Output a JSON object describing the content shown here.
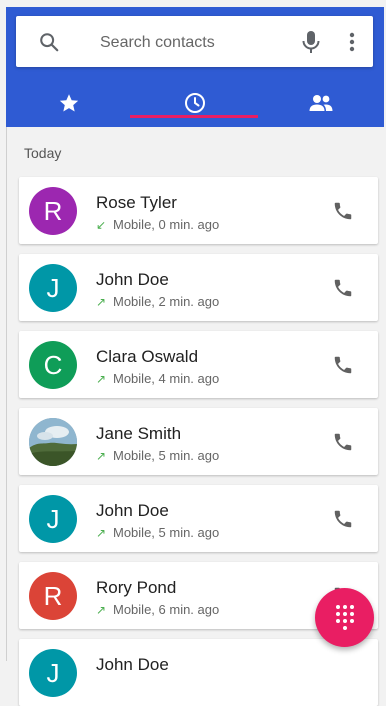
{
  "search": {
    "placeholder": "Search contacts"
  },
  "tabs": [
    {
      "icon": "star-icon",
      "label": "Favorites"
    },
    {
      "icon": "clock-icon",
      "label": "Recents"
    },
    {
      "icon": "people-icon",
      "label": "Contacts"
    }
  ],
  "colors": {
    "appbar": "#2f5bd3",
    "accent": "#e91e63",
    "incoming": "#4caf50",
    "outgoing": "#4caf50"
  },
  "section_title": "Today",
  "calls": [
    {
      "name": "Rose Tyler",
      "initial": "R",
      "avatar_color": "#9c27b0",
      "direction": "incoming",
      "arrow": "↙",
      "detail": "Mobile, 0 min. ago"
    },
    {
      "name": "John Doe",
      "initial": "J",
      "avatar_color": "#0097a7",
      "direction": "outgoing",
      "arrow": "↗",
      "detail": "Mobile, 2 min. ago"
    },
    {
      "name": "Clara Oswald",
      "initial": "C",
      "avatar_color": "#0f9d58",
      "direction": "outgoing",
      "arrow": "↗",
      "detail": "Mobile, 4 min. ago"
    },
    {
      "name": "Jane Smith",
      "initial": "",
      "avatar_color": "#7a9aa8",
      "direction": "outgoing",
      "arrow": "↗",
      "detail": "Mobile, 5 min. ago"
    },
    {
      "name": "John Doe",
      "initial": "J",
      "avatar_color": "#0097a7",
      "direction": "outgoing",
      "arrow": "↗",
      "detail": "Mobile, 5 min. ago"
    },
    {
      "name": "Rory Pond",
      "initial": "R",
      "avatar_color": "#db4437",
      "direction": "outgoing",
      "arrow": "↗",
      "detail": "Mobile, 6 min. ago"
    },
    {
      "name": "John Doe",
      "initial": "J",
      "avatar_color": "#0097a7",
      "direction": "outgoing",
      "arrow": "↗",
      "detail": ""
    }
  ]
}
